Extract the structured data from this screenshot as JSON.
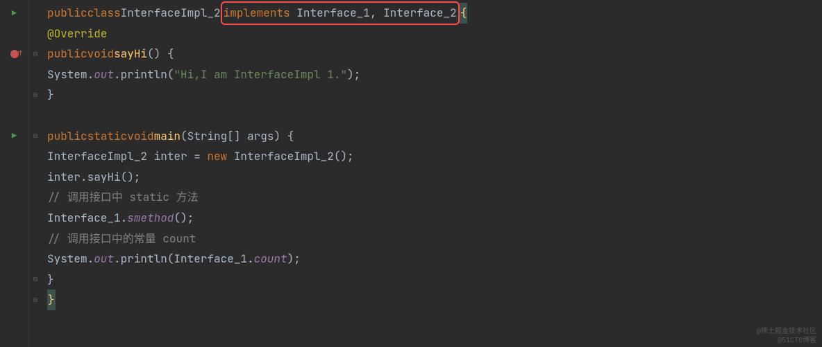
{
  "code": {
    "line1": {
      "kw_public": "public",
      "kw_class": "class",
      "class_name": "InterfaceImpl_2",
      "kw_implements": "implements",
      "iface1": "Interface_1",
      "comma": ", ",
      "iface2": "Interface_2",
      "brace": "{"
    },
    "line2": {
      "annotation": "@Override"
    },
    "line3": {
      "kw_public": "public",
      "kw_void": "void",
      "method": "sayHi",
      "parens": "()",
      "brace": " {"
    },
    "line4": {
      "system": "System.",
      "out": "out",
      "println": ".println(",
      "str": "\"Hi,I am InterfaceImpl 1.\"",
      "close": ");"
    },
    "line5": {
      "brace": "}"
    },
    "line7": {
      "kw_public": "public",
      "kw_static": "static",
      "kw_void": "void",
      "method": "main",
      "open": "(",
      "type": "String",
      "brackets": "[]",
      "args": " args",
      "close": ")",
      "brace": " {"
    },
    "line8": {
      "type1": "InterfaceImpl_2",
      "var": " inter = ",
      "kw_new": "new",
      "type2": " InterfaceImpl_2",
      "parens": "();"
    },
    "line9": {
      "call": "inter.sayHi();"
    },
    "line10": {
      "comment": "// 调用接口中 static 方法"
    },
    "line11": {
      "type": "Interface_1.",
      "method": "smethod",
      "parens": "();"
    },
    "line12": {
      "comment": "// 调用接口中的常量 count"
    },
    "line13": {
      "system": "System.",
      "out": "out",
      "println": ".println(Interface_1.",
      "count": "count",
      "close": ");"
    },
    "line14": {
      "brace": "}"
    },
    "line15": {
      "brace": "}"
    }
  },
  "watermark": {
    "line1": "@稀土掘金技术社区",
    "line2": "@51CTO博客"
  }
}
